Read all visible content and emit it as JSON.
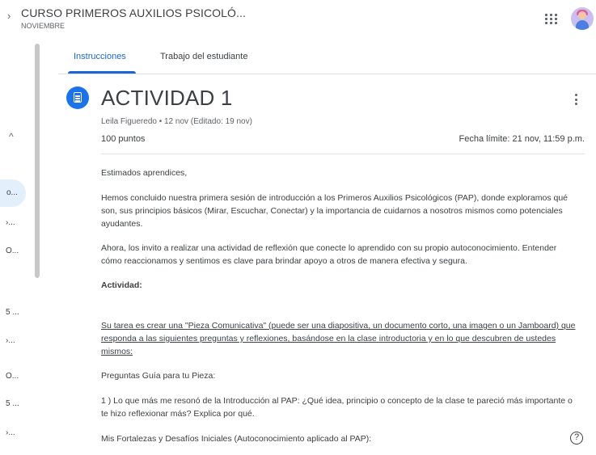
{
  "header": {
    "course_title": "CURSO PRIMEROS AUXILIOS PSICOLÓ...",
    "course_subtitle": "NOVIEMBRE",
    "nav_chevron": "›"
  },
  "sidebar": {
    "collapse_chevron": "^",
    "items": [
      {
        "label": "o..."
      },
      {
        "label": "›..."
      },
      {
        "label": "O..."
      },
      {
        "label": "5 ..."
      },
      {
        "label": "›..."
      },
      {
        "label": "O..."
      },
      {
        "label": "5 ..."
      },
      {
        "label": "›..."
      }
    ]
  },
  "tabs": [
    {
      "label": "Instrucciones",
      "active": true
    },
    {
      "label": "Trabajo del estudiante",
      "active": false
    }
  ],
  "assignment": {
    "title": "ACTIVIDAD 1",
    "meta": "Leila Figueredo • 12 nov (Editado: 19 nov)",
    "points": "100 puntos",
    "due": "Fecha límite: 21 nov, 11:59 p.m."
  },
  "body": {
    "greeting": "Estimados aprendices,",
    "p1": "Hemos concluido nuestra primera sesión de introducción a los Primeros Auxilios Psicológicos (PAP), donde exploramos qué son, sus principios básicos (Mirar, Escuchar, Conectar) y la importancia de cuidarnos a nosotros mismos como potenciales ayudantes.",
    "p2": "Ahora, los invito a realizar una actividad de reflexión que conecte lo aprendido con su propio autoconocimiento. Entender cómo reaccionamos y sentimos es clave para brindar apoyo a otros de manera efectiva y segura.",
    "activity_heading": "Actividad:",
    "task": "Su tarea es crear una \"Pieza Comunicativa\" (puede ser una diapositiva, un documento corto, una imagen o un Jamboard) que responda a las siguientes preguntas y reflexiones, basándose en la clase introductoria y en lo que descubren de ustedes mismos:",
    "guide_heading": "Preguntas Guía para tu Pieza:",
    "q1": "1 ) Lo que más me resonó de la Introducción al PAP: ¿Qué idea, principio o concepto de la clase te pareció más importante o te hizo reflexionar más? Explica por qué.",
    "q2": "Mis Fortalezas y Desafíos Iniciales (Autoconocimiento aplicado al PAP):"
  },
  "help": {
    "glyph": "?"
  },
  "colors": {
    "accent": "#1967d2",
    "icon_bg": "#1a73e8",
    "text": "#3c4043",
    "muted": "#5f6368"
  },
  "icons": [
    "apps-grid-icon",
    "avatar",
    "assignment-icon",
    "more-vert-icon",
    "help-icon"
  ]
}
